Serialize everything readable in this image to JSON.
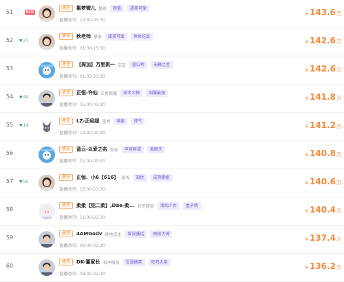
{
  "labels": {
    "live_time_prefix": "直播时间：",
    "platform": "虎牙",
    "new_badge": "NEW",
    "currency_symbol": "¥",
    "unit": "万"
  },
  "colors": {
    "heat": "#f28a3a",
    "platform_tag": "#ee8a2e",
    "tag_text": "#6d5bc7",
    "tag_bg": "#efeafc",
    "rise_arrow": "#23b04a",
    "new_badge": "#f26b7d"
  },
  "rows": [
    {
      "rank": "51",
      "change": "",
      "is_new": true,
      "name": "集梦微儿",
      "category": "星秀",
      "tags": [
        "颜值",
        "甜美可爱"
      ],
      "live_time": "12:30-00:30",
      "heat": "143.6",
      "avatar": "avatar-woman-icon"
    },
    {
      "rank": "52",
      "change": "27",
      "is_new": false,
      "name": "秋老师",
      "category": "星秀",
      "tags": [
        "甜美可爱",
        "乖乖吃饭"
      ],
      "live_time": "01:30-15:30",
      "heat": "142.6",
      "avatar": "avatar-woman-icon"
    },
    {
      "rank": "53",
      "change": "",
      "is_new": false,
      "name": "【探加】万里挑一",
      "category": "交友",
      "tags": [
        "旋口秀",
        "天籁之音"
      ],
      "live_time": "01:00-23:30",
      "heat": "142.6",
      "avatar": "avatar-cartoon-icon"
    },
    {
      "rank": "54",
      "change": "40",
      "is_new": false,
      "name": "正恒-许仙",
      "category": "王者荣耀",
      "tags": [
        "技术大神",
        "国服最强"
      ],
      "live_time": "15:00-03:30",
      "heat": "141.8",
      "avatar": "avatar-man-icon"
    },
    {
      "rank": "55",
      "change": "14",
      "is_new": false,
      "name": "LZ-正经超",
      "category": "星秀",
      "tags": [
        "喊麦",
        "帅气"
      ],
      "live_time": "14:30-00:30",
      "heat": "141.2",
      "avatar": "avatar-fox-icon"
    },
    {
      "rank": "56",
      "change": "",
      "is_new": false,
      "name": "蓝云-以爱之名",
      "category": "交友",
      "tags": [
        "声音醉甜",
        "爱聊天"
      ],
      "live_time": "01:00-00:00",
      "heat": "140.8",
      "avatar": "avatar-cartoon-icon"
    },
    {
      "rank": "57",
      "change": "50",
      "is_new": false,
      "name": "正恒、小6【616】",
      "category": "星秀",
      "tags": [
        "知性",
        "成熟御姐"
      ],
      "live_time": "15:00-21:30",
      "heat": "140.6",
      "avatar": "avatar-woman-icon"
    },
    {
      "rank": "58",
      "change": "",
      "is_new": false,
      "name": "柔柔【犯二柔】,Dae-柔...",
      "category": "和平精英",
      "tags": [
        "清纯少女",
        "盒子精"
      ],
      "live_time": "11:00-22:30",
      "heat": "140.4",
      "avatar": "avatar-anime-icon"
    },
    {
      "rank": "59",
      "change": "",
      "is_new": false,
      "name": "4AMGodv",
      "category": "绝地求生",
      "tags": [
        "爱说骚话",
        "刚枪大神"
      ],
      "live_time": "09:00-02:30",
      "heat": "137.4",
      "avatar": "avatar-man-icon"
    },
    {
      "rank": "60",
      "change": "",
      "is_new": false,
      "name": "DK-董家长",
      "category": "和平精英",
      "tags": [
        "逗逼搞笑",
        "吃鸡大佬"
      ],
      "live_time": "09:00-22:30",
      "heat": "136.2",
      "avatar": "avatar-man-icon"
    }
  ]
}
